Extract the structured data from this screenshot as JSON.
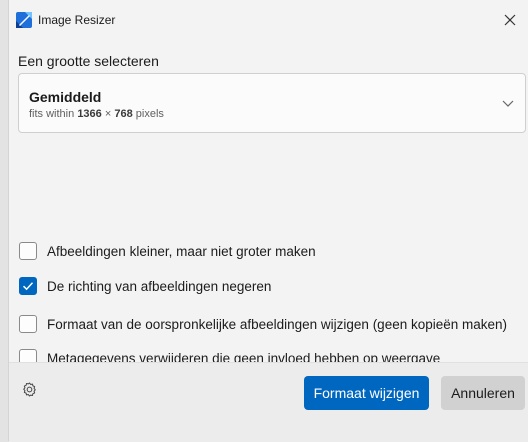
{
  "window": {
    "title": "Image Resizer",
    "close_icon": "close-icon"
  },
  "size_section": {
    "label": "Een grootte selecteren",
    "selected": {
      "name": "Gemiddeld",
      "desc_prefix": "fits within",
      "width": "1366",
      "times": "×",
      "height": "768",
      "unit": "pixels"
    }
  },
  "options": [
    {
      "label": "Afbeeldingen kleiner, maar niet groter maken",
      "checked": false
    },
    {
      "label": "De richting van afbeeldingen negeren",
      "checked": true
    },
    {
      "label": "Formaat van de oorspronkelijke afbeeldingen wijzigen (geen kopieën maken)",
      "checked": false
    },
    {
      "label": "Metagegevens verwijderen die geen invloed hebben op weergave",
      "checked": false
    }
  ],
  "footer": {
    "settings_icon": "gear-icon",
    "primary_label": "Formaat wijzigen",
    "cancel_label": "Annuleren"
  },
  "colors": {
    "accent": "#0067c0",
    "background": "#f3f3f3"
  }
}
